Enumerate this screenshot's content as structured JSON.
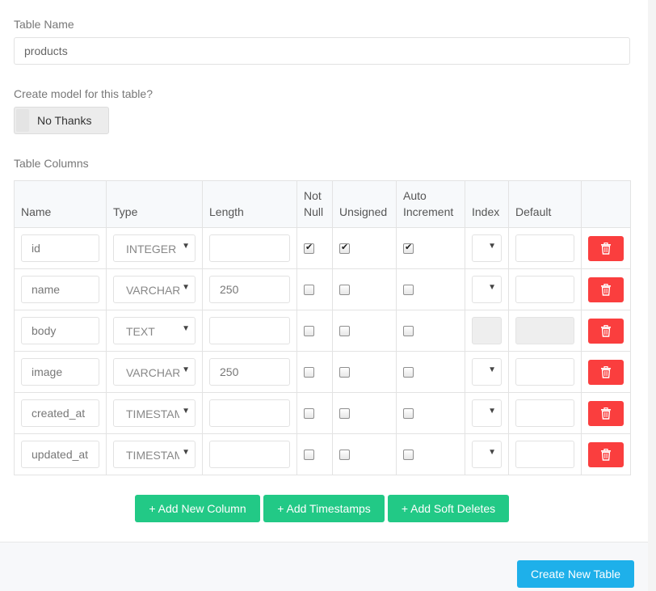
{
  "table_name": {
    "label": "Table Name",
    "value": "products"
  },
  "model": {
    "label": "Create model for this table?",
    "toggle_label": "No Thanks"
  },
  "columns_section": {
    "label": "Table Columns",
    "headers": {
      "name": "Name",
      "type": "Type",
      "length": "Length",
      "not_null_1": "Not",
      "not_null_2": "Null",
      "unsigned": "Unsigned",
      "auto_inc_1": "Auto",
      "auto_inc_2": "Increment",
      "index": "Index",
      "default": "Default"
    },
    "rows": [
      {
        "name": "id",
        "type": "INTEGER",
        "length": "",
        "not_null": true,
        "unsigned": true,
        "auto_increment": true,
        "index": "",
        "default": "",
        "disabled": false
      },
      {
        "name": "name",
        "type": "VARCHAR",
        "length": "250",
        "not_null": false,
        "unsigned": false,
        "auto_increment": false,
        "index": "",
        "default": "",
        "disabled": false
      },
      {
        "name": "body",
        "type": "TEXT",
        "length": "",
        "not_null": false,
        "unsigned": false,
        "auto_increment": false,
        "index": "",
        "default": "",
        "disabled": true
      },
      {
        "name": "image",
        "type": "VARCHAR",
        "length": "250",
        "not_null": false,
        "unsigned": false,
        "auto_increment": false,
        "index": "",
        "default": "",
        "disabled": false
      },
      {
        "name": "created_at",
        "type": "TIMESTAMP",
        "length": "",
        "not_null": false,
        "unsigned": false,
        "auto_increment": false,
        "index": "",
        "default": "",
        "disabled": false
      },
      {
        "name": "updated_at",
        "type": "TIMESTAMP",
        "length": "",
        "not_null": false,
        "unsigned": false,
        "auto_increment": false,
        "index": "",
        "default": "",
        "disabled": false
      }
    ]
  },
  "actions": {
    "add_column": "+ Add New Column",
    "add_timestamps": "+ Add Timestamps",
    "add_soft_deletes": "+ Add Soft Deletes"
  },
  "footer": {
    "create_label": "Create New Table"
  },
  "icons": {
    "delete": "trash-icon",
    "select_caret": "caret-down-icon"
  },
  "colors": {
    "delete_button": "#fa3e3e",
    "action_button": "#22c986",
    "primary_button": "#1eb0ea"
  }
}
